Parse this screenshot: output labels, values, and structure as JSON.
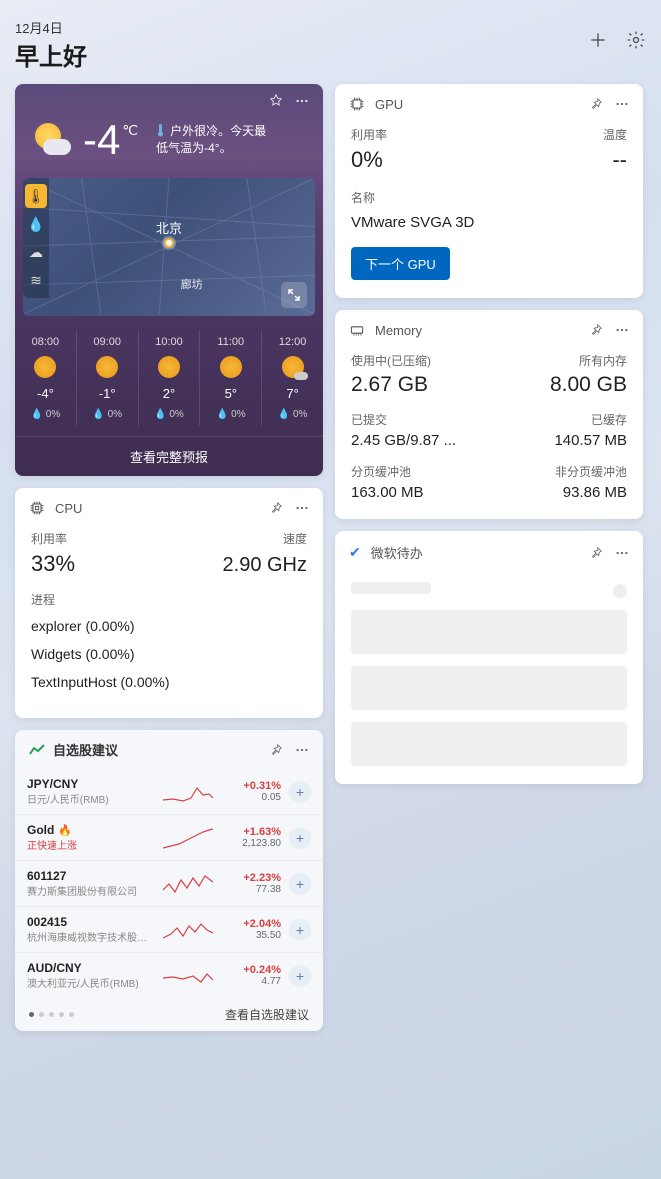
{
  "header": {
    "date": "12月4日",
    "greeting": "早上好"
  },
  "weather": {
    "temp": "-4",
    "unit": "℃",
    "desc_line1": "户外很冷。今天最",
    "desc_line2": "低气温为-4°。",
    "city": "北京",
    "city2": "廊坊",
    "hourly": [
      {
        "time": "08:00",
        "temp": "-4°",
        "precip": "0%",
        "cloudy": false
      },
      {
        "time": "09:00",
        "temp": "-1°",
        "precip": "0%",
        "cloudy": false
      },
      {
        "time": "10:00",
        "temp": "2°",
        "precip": "0%",
        "cloudy": false
      },
      {
        "time": "11:00",
        "temp": "5°",
        "precip": "0%",
        "cloudy": false
      },
      {
        "time": "12:00",
        "temp": "7°",
        "precip": "0%",
        "cloudy": true
      }
    ],
    "footer": "查看完整预报"
  },
  "cpu": {
    "title": "CPU",
    "util_label": "利用率",
    "speed_label": "速度",
    "util": "33%",
    "speed": "2.90 GHz",
    "proc_label": "进程",
    "procs": [
      "explorer (0.00%)",
      "Widgets (0.00%)",
      "TextInputHost (0.00%)"
    ]
  },
  "stocks": {
    "title": "自选股建议",
    "rows": [
      {
        "sym": "JPY/CNY",
        "name": "日元/人民币(RMB)",
        "change": "+0.31%",
        "price": "0.05",
        "fire": false,
        "rising": false
      },
      {
        "sym": "Gold",
        "name": "正快速上涨",
        "change": "+1.63%",
        "price": "2,123.80",
        "fire": true,
        "rising": true
      },
      {
        "sym": "601127",
        "name": "赛力斯集团股份有限公司",
        "change": "+2.23%",
        "price": "77.38",
        "fire": false,
        "rising": false
      },
      {
        "sym": "002415",
        "name": "杭州海康威视数字技术股份...",
        "change": "+2.04%",
        "price": "35.50",
        "fire": false,
        "rising": false
      },
      {
        "sym": "AUD/CNY",
        "name": "澳大利亚元/人民币(RMB)",
        "change": "+0.24%",
        "price": "4.77",
        "fire": false,
        "rising": false
      }
    ],
    "footer": "查看自选股建议"
  },
  "gpu": {
    "title": "GPU",
    "util_label": "利用率",
    "temp_label": "温度",
    "util": "0%",
    "temp": "--",
    "name_label": "名称",
    "name": "VMware SVGA 3D",
    "button": "下一个 GPU"
  },
  "memory": {
    "title": "Memory",
    "used_label": "使用中(已压缩)",
    "total_label": "所有内存",
    "used": "2.67 GB",
    "total": "8.00 GB",
    "committed_label": "已提交",
    "cached_label": "已缓存",
    "committed": "2.45 GB/9.87 ...",
    "cached": "140.57 MB",
    "paged_label": "分页缓冲池",
    "nonpaged_label": "非分页缓冲池",
    "paged": "163.00 MB",
    "nonpaged": "93.86 MB"
  },
  "todo": {
    "title": "微软待办"
  }
}
